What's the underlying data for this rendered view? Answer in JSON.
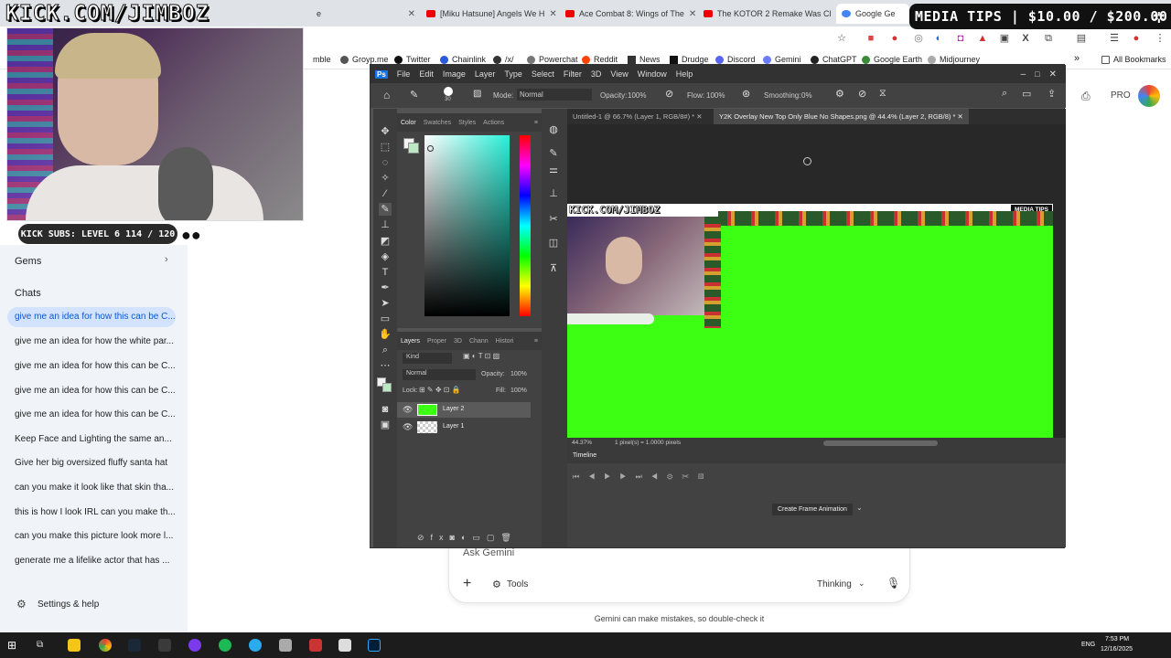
{
  "browser": {
    "tabs": [
      {
        "label": "..."
      },
      {
        "label": "e"
      },
      {
        "label": "[Miku Hatsune] Angels We H"
      },
      {
        "label": "Ace Combat 8: Wings of The"
      },
      {
        "label": "The KOTOR 2 Remake Was Cl"
      },
      {
        "label": "Google Ge"
      }
    ],
    "bookmarks": [
      "mble",
      "Groyp.me",
      "Twitter",
      "Chainlink",
      "/x/",
      "Powerchat",
      "Reddit",
      "News",
      "Drudge",
      "Discord",
      "Gemini",
      "ChatGPT",
      "Google Earth",
      "Midjourney"
    ],
    "bookmarks_more": "»",
    "all_bookmarks": "All Bookmarks",
    "pro_label": "PRO"
  },
  "overlay": {
    "kick_url": "KICK.COM/JIMBOZ",
    "media_tips": "MEDIA TIPS | $10.00 / $200.00",
    "kick_subs": "KICK SUBS: LEVEL 6 114 / 120"
  },
  "sidebar": {
    "gems_label": "Gems",
    "chats_label": "Chats",
    "chats": [
      "give me an idea for how this can be C...",
      "give me an idea for how the white par...",
      "give me an idea for how this can be C...",
      "give me an idea for how this can be C...",
      "give me an idea for how this can be C...",
      "Keep Face and Lighting the same an...",
      "Give her big oversized fluffy santa hat",
      "can you make it look like that skin tha...",
      "this is how I look IRL can you make th...",
      "can you make this picture look more l...",
      "generate me a lifelike actor that has ..."
    ],
    "settings_label": "Settings & help"
  },
  "gemini": {
    "ask_placeholder": "Ask Gemini",
    "add_label": "+",
    "tools_label": "Tools",
    "mode_label": "Thinking",
    "disclaimer": "Gemini can make mistakes, so double-check it"
  },
  "photoshop": {
    "menu": [
      "File",
      "Edit",
      "Image",
      "Layer",
      "Type",
      "Select",
      "Filter",
      "3D",
      "View",
      "Window",
      "Help"
    ],
    "options": {
      "brush_size": "30",
      "mode_label": "Mode:",
      "mode_value": "Normal",
      "opacity_label": "Opacity:",
      "opacity_value": "100%",
      "flow_label": "Flow:",
      "flow_value": "100%",
      "smoothing_label": "Smoothing:",
      "smoothing_value": "0%"
    },
    "color_tabs": [
      "Color",
      "Swatches",
      "Styles",
      "Actions"
    ],
    "layer_tabs": [
      "Layers",
      "Proper",
      "3D",
      "Chann",
      "Histori"
    ],
    "layers_kind": "Kind",
    "blend_mode": "Normal",
    "layer_opacity_label": "Opacity:",
    "layer_opacity_value": "100%",
    "lock_label": "Lock:",
    "fill_label": "Fill:",
    "fill_value": "100%",
    "layers": [
      "Layer 2",
      "Layer 1"
    ],
    "doc_tabs": [
      "Untitled-1 @ 66.7% (Layer 1, RGB/8#) *",
      "Y2K Overlay New Top Only Blue No Shapes.png @ 44.4% (Layer 2, RGB/8) *"
    ],
    "canvas_overlay": {
      "kick_url": "KICK.COM/JIMBOZ",
      "media_tips": "MEDIA TIPS"
    },
    "status": {
      "zoom": "44.37%",
      "pixels": "1 pixel(s) = 1.0000 pixels"
    },
    "timeline_label": "Timeline",
    "create_frame_label": "Create Frame Animation"
  },
  "taskbar": {
    "lang": "ENG",
    "time": "7:53 PM",
    "date": "12/16/2025"
  },
  "colors": {
    "green_screen": "#3cff14",
    "ps_bg": "#535353",
    "sidebar_bg": "#f0f4f9",
    "selected_chat": "#d3e3fd"
  }
}
